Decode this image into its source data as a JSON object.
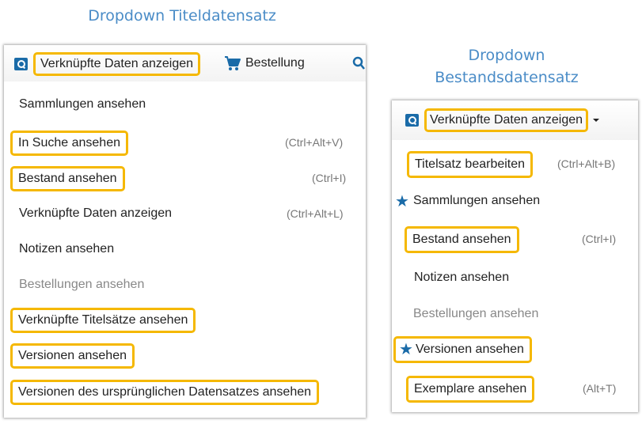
{
  "captions": {
    "title_left": "Dropdown Titeldatensatz",
    "title_right_line1": "Dropdown",
    "title_right_line2": "Bestandsdatensatz"
  },
  "left": {
    "toolbar": {
      "linked_data_label": "Verknüpfte Daten anzeigen",
      "order_label": "Bestellung",
      "search_icon": "search-icon",
      "cart_icon": "cart-icon"
    },
    "items": [
      {
        "label": "Sammlungen ansehen",
        "shortcut": ""
      },
      {
        "label": "In Suche ansehen",
        "shortcut": "(Ctrl+Alt+V)"
      },
      {
        "label": "Bestand ansehen",
        "shortcut": "(Ctrl+I)"
      },
      {
        "label": "Verknüpfte Daten anzeigen",
        "shortcut": "(Ctrl+Alt+L)"
      },
      {
        "label": "Notizen ansehen",
        "shortcut": ""
      },
      {
        "label": "Bestellungen ansehen",
        "shortcut": ""
      },
      {
        "label": "Verknüpfte Titelsätze ansehen",
        "shortcut": ""
      },
      {
        "label": "Versionen ansehen",
        "shortcut": ""
      },
      {
        "label": "Versionen des ursprünglichen Datensatzes ansehen",
        "shortcut": ""
      }
    ]
  },
  "right": {
    "toolbar": {
      "linked_data_label": "Verknüpfte Daten anzeigen"
    },
    "items": [
      {
        "label": "Titelsatz bearbeiten",
        "shortcut": "(Ctrl+Alt+B)"
      },
      {
        "label": "Sammlungen ansehen",
        "shortcut": ""
      },
      {
        "label": "Bestand ansehen",
        "shortcut": "(Ctrl+I)"
      },
      {
        "label": "Notizen ansehen",
        "shortcut": ""
      },
      {
        "label": "Bestellungen ansehen",
        "shortcut": ""
      },
      {
        "label": "Versionen ansehen",
        "shortcut": ""
      },
      {
        "label": "Exemplare ansehen",
        "shortcut": "(Alt+T)"
      }
    ],
    "star_glyph": "★"
  },
  "colors": {
    "caption": "#4a8cc7",
    "highlight": "#f5b800",
    "brand": "#1a6ba8"
  }
}
